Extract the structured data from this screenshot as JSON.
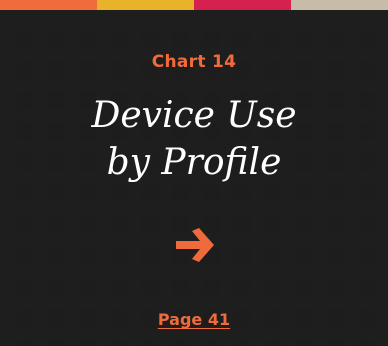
{
  "top_bar": {
    "colors": [
      "#f26b3a",
      "#e8b22a",
      "#d6204d",
      "#c7bca8"
    ]
  },
  "card": {
    "chart_label": "Chart 14",
    "title_line_1": "Device Use",
    "title_line_2": "by Profile",
    "arrow_icon": "right-arrow-icon",
    "page_link": "Page 41",
    "accent_color": "#f06b3b"
  }
}
